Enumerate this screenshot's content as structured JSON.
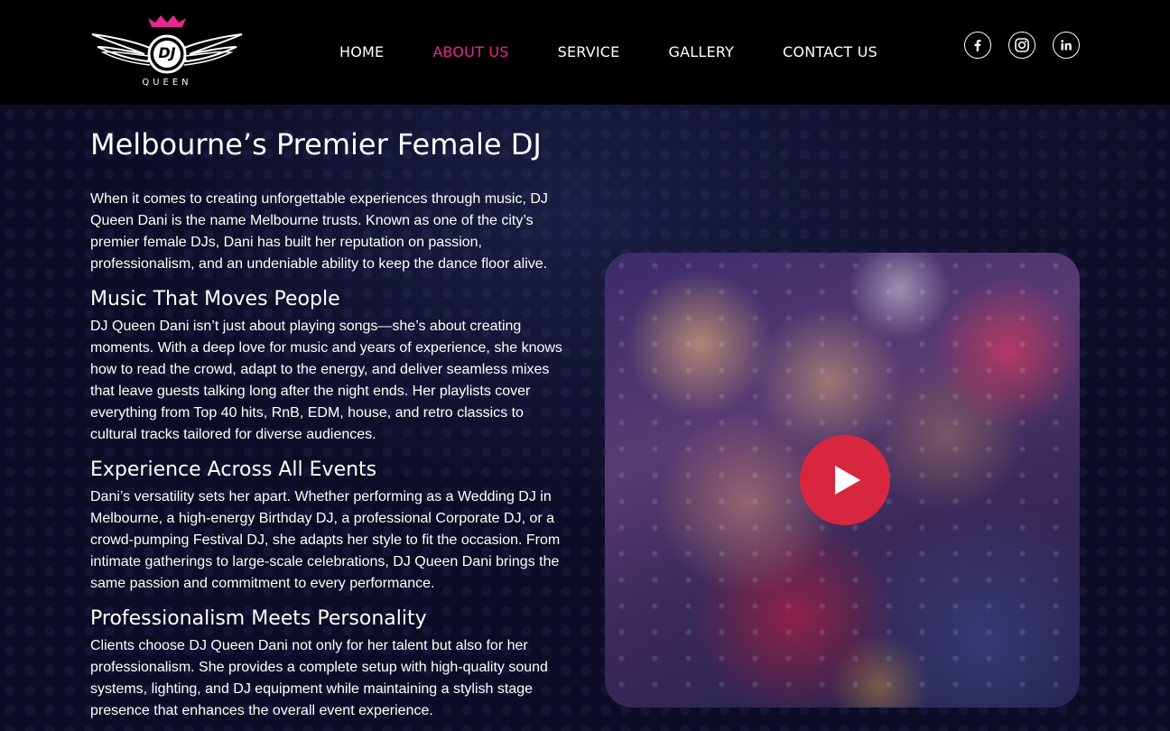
{
  "brand": {
    "logo_text": "QUEEN",
    "logo_mark": "DJ",
    "accent_color": "#e8288f"
  },
  "nav": {
    "items": [
      {
        "label": "HOME",
        "active": false
      },
      {
        "label": "ABOUT US",
        "active": true
      },
      {
        "label": "SERVICE",
        "active": false
      },
      {
        "label": "GALLERY",
        "active": false
      },
      {
        "label": "CONTACT US",
        "active": false
      }
    ]
  },
  "social": {
    "icons": [
      "facebook-icon",
      "instagram-icon",
      "linkedin-icon"
    ]
  },
  "main": {
    "title": "Melbourne’s Premier Female DJ",
    "intro": "When it comes to creating unforgettable experiences through music, DJ Queen Dani is the name Melbourne trusts. Known as one of the city’s premier female DJs, Dani has built her reputation on passion, professionalism, and an undeniable ability to keep the dance floor alive.",
    "sections": [
      {
        "heading": "Music That Moves People",
        "body": "DJ Queen Dani isn’t just about playing songs—she’s about creating moments. With a deep love for music and years of experience, she knows how to read the crowd, adapt to the energy, and deliver seamless mixes that leave guests talking long after the night ends. Her playlists cover everything from Top 40 hits, RnB, EDM, house, and retro classics to cultural tracks tailored for diverse audiences."
      },
      {
        "heading": "Experience Across All Events",
        "body": "Dani’s versatility sets her apart. Whether performing as a Wedding DJ in Melbourne, a high-energy Birthday DJ, a professional Corporate DJ, or a crowd-pumping Festival DJ, she adapts her style to fit the occasion. From intimate gatherings to large-scale celebrations, DJ Queen Dani brings the same passion and commitment to every performance."
      },
      {
        "heading": "Professionalism Meets Personality",
        "body": "Clients choose DJ Queen Dani not only for her talent but also for her professionalism. She provides a complete setup with high-quality sound systems, lighting, and DJ equipment while maintaining a stylish stage presence that enhances the overall event experience."
      }
    ]
  },
  "video": {
    "play_icon": "play-icon",
    "play_color": "#d9263f"
  }
}
